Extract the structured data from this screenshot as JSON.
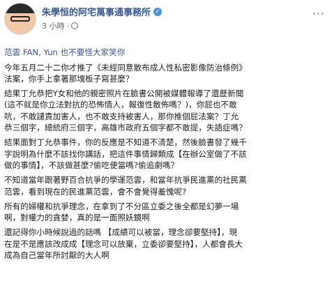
{
  "post": {
    "author": "朱學恒的阿宅萬事通事務所",
    "timestamp": "3 小時",
    "dot": "·",
    "more": "···",
    "verified_mark": "✓",
    "mention_line": "范雲 FAN, Yun 也不要怪大家笑你",
    "paragraphs": [
      "今年五月二十二你才推了《未經同意散布成人性私密影像防治條例》\n法案，你手上拿著那塊板子寫甚麼？",
      "結果丁允恭把Y女和他的親密照片在臉書公開被媒體報導了還歷新聞\n(這不就是你立法對抗的恐怖情人，報復性散佈嗎？)，你屁也不敢\n吭，不敢譴責加害人，也不敢支持被害人，那你推個屁法案？丁允\n恭三個字，總統府三個字，高雄市政府五個字都不敢提，失語症嗎？",
      "結果面對丁允恭事件，你的反應是不知道不清楚，然後臉書發了幾千\n字說明為什麼不該找你講話，把這件事情歸類成【在辦公室做了不該\n做的事情】，不該做甚麼?偷吃便當嗎?偷追劇嗎？",
      "不知道當年跟著野百合抗爭的學運范雲，和當年抗爭民進黨的社民黨\n范雲，看到現在的民進黨范雲，會不會覺得羞愧呢?",
      "所有的婦權和抗爭理念，在拿到了不分區立委之後全都是幻夢一場\n啊，對權力的貪婪，真的是一面照妖鏡啊",
      "還記得你小時候說過的話嗎 【成績可以被當，理念卻要堅持】，現\n在是不是應該改成成【理念可以放棄，立委卻要堅持】，人都會長大\n成為自己當年所討厭的大人啊"
    ]
  },
  "colors": {
    "name": "#385898",
    "mention": "#365899",
    "text": "#1c1e21",
    "meta": "#616770",
    "verified": "#4a90e2"
  },
  "icons": {
    "avatar": "profile-photo",
    "verified": "verified-badge-icon",
    "privacy": "globe-icon",
    "menu": "more-options-icon"
  }
}
